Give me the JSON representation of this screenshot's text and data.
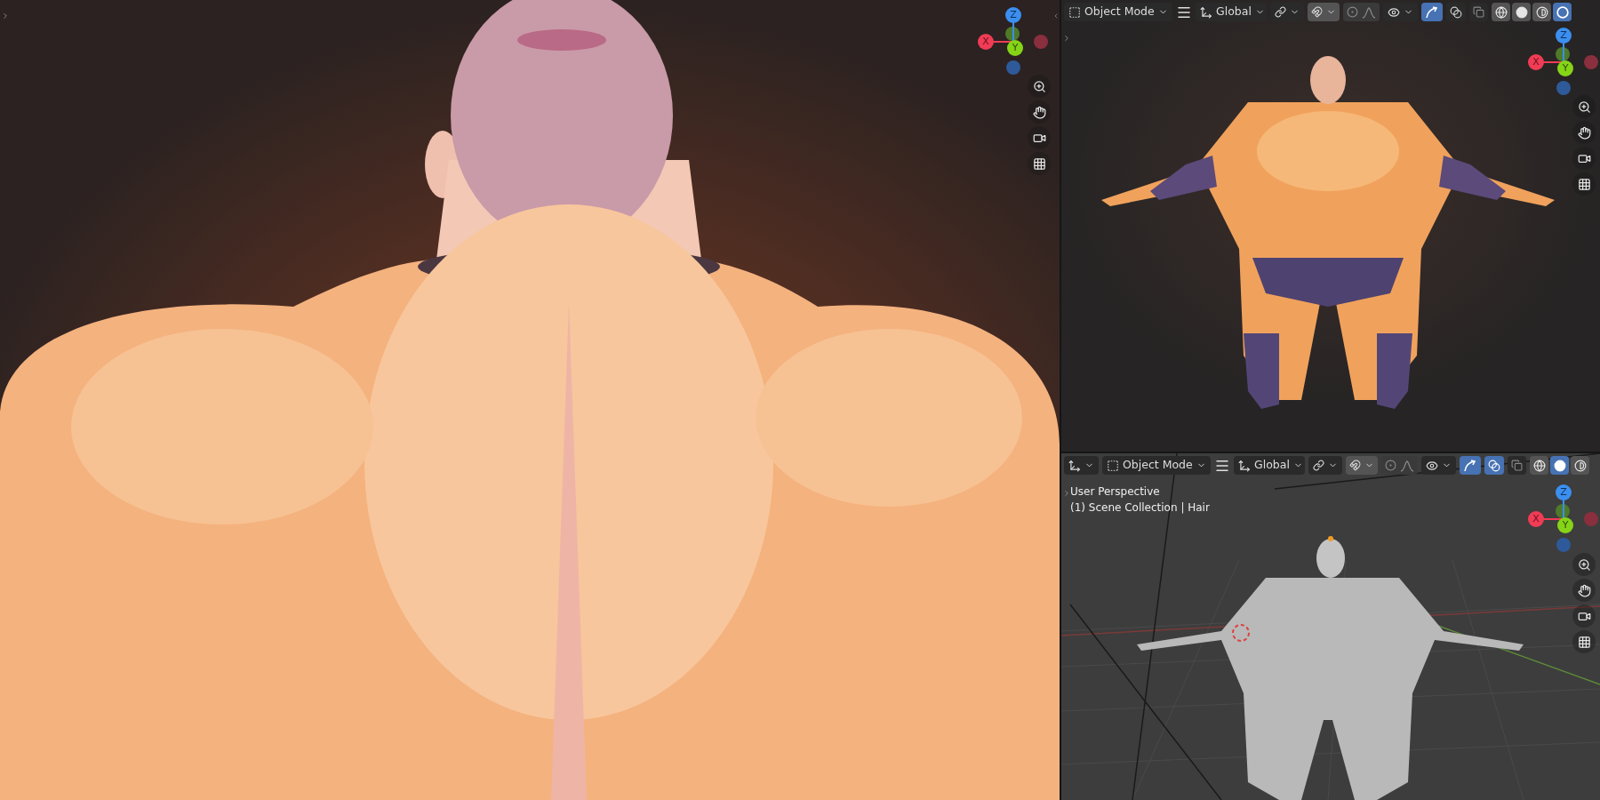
{
  "viewports": [
    {
      "kind": "closeup",
      "gizmo": {
        "x": "X",
        "y": "Y",
        "z": "Z"
      }
    },
    {
      "kind": "rendered",
      "header": {
        "pivot_menu": false,
        "mode": "Object Mode",
        "orientation": "Global",
        "proportional_editing": false,
        "gizmos_on": true,
        "overlays_on": false,
        "shading": [
          {
            "kind": "wireframe",
            "selected": false
          },
          {
            "kind": "solid",
            "selected": false
          },
          {
            "kind": "material",
            "selected": false
          },
          {
            "kind": "rendered",
            "selected": true
          }
        ]
      },
      "gizmo": {
        "x": "X",
        "y": "Y",
        "z": "Z"
      }
    },
    {
      "kind": "solid",
      "header": {
        "pivot_menu": true,
        "mode": "Object Mode",
        "orientation": "Global",
        "proportional_editing": false,
        "gizmos_on": true,
        "overlays_on": true,
        "shading": [
          {
            "kind": "wireframe",
            "selected": false
          },
          {
            "kind": "solid",
            "selected": true
          },
          {
            "kind": "material",
            "selected": false
          }
        ]
      },
      "overlay_lines": [
        "User Perspective",
        "(1) Scene Collection | Hair"
      ],
      "gizmo": {
        "x": "X",
        "y": "Y",
        "z": "Z"
      }
    }
  ]
}
